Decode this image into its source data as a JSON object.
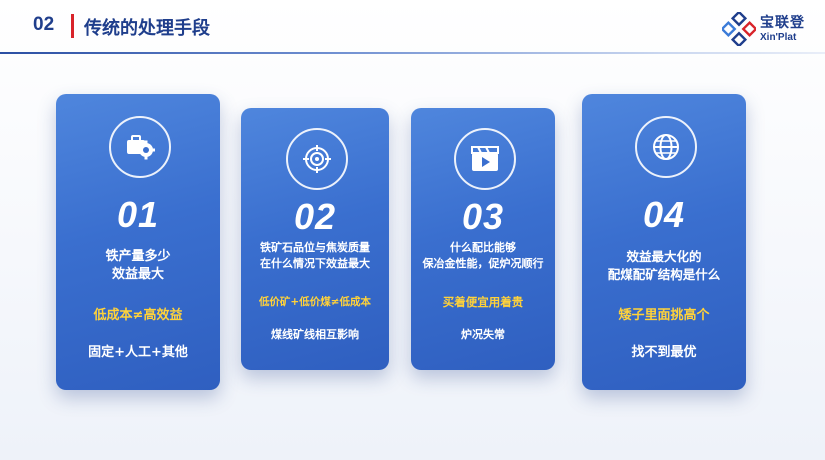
{
  "header": {
    "section_number": "02",
    "title": "传统的处理手段",
    "logo_cn": "宝联登",
    "logo_en": "Xin'Plat"
  },
  "cards": [
    {
      "icon": "gear-toolbox-icon",
      "number": "01",
      "question": [
        "铁产量多少",
        "效益最大"
      ],
      "highlight": "低成本≠高效益",
      "note": "固定+人工+其他"
    },
    {
      "icon": "target-icon",
      "number": "02",
      "question": [
        "铁矿石品位与焦炭质量",
        "在什么情况下效益最大"
      ],
      "highlight": "低价矿+低价煤≠低成本",
      "note": "煤线矿线相互影响"
    },
    {
      "icon": "video-camera-icon",
      "number": "03",
      "question": [
        "什么配比能够",
        "保冶金性能，促炉况顺行"
      ],
      "highlight": "买着便宜用着贵",
      "note": "炉况失常"
    },
    {
      "icon": "globe-icon",
      "number": "04",
      "question": [
        "效益最大化的",
        "配煤配矿结构是什么"
      ],
      "highlight": "矮子里面挑高个",
      "note": "找不到最优"
    }
  ],
  "colors": {
    "title": "#1f3e8c",
    "accent_bar": "#d8232a",
    "card_blue": "#3a6fcf",
    "highlight": "#ffd23a"
  }
}
